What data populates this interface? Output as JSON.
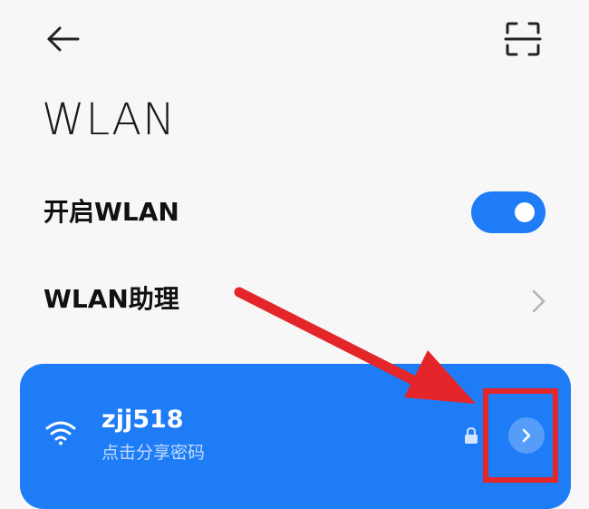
{
  "header": {
    "back_icon": "arrow-left-icon",
    "scan_icon": "scan-qr-icon",
    "title": "WLAN"
  },
  "settings": {
    "wlan_toggle": {
      "label": "开启WLAN",
      "state": "on"
    },
    "wlan_assistant": {
      "label": "WLAN助理",
      "icon": "chevron-right-icon"
    }
  },
  "connected_network": {
    "name": "zjj518",
    "subtitle": "点击分享密码",
    "icons": [
      "wifi-icon",
      "lock-icon",
      "chevron-right-icon"
    ]
  },
  "annotations": {
    "color": "#e4252a"
  },
  "colors": {
    "accent": "#1e7cf7",
    "background": "#f7f7f7",
    "annotation_red": "#e4252a"
  }
}
